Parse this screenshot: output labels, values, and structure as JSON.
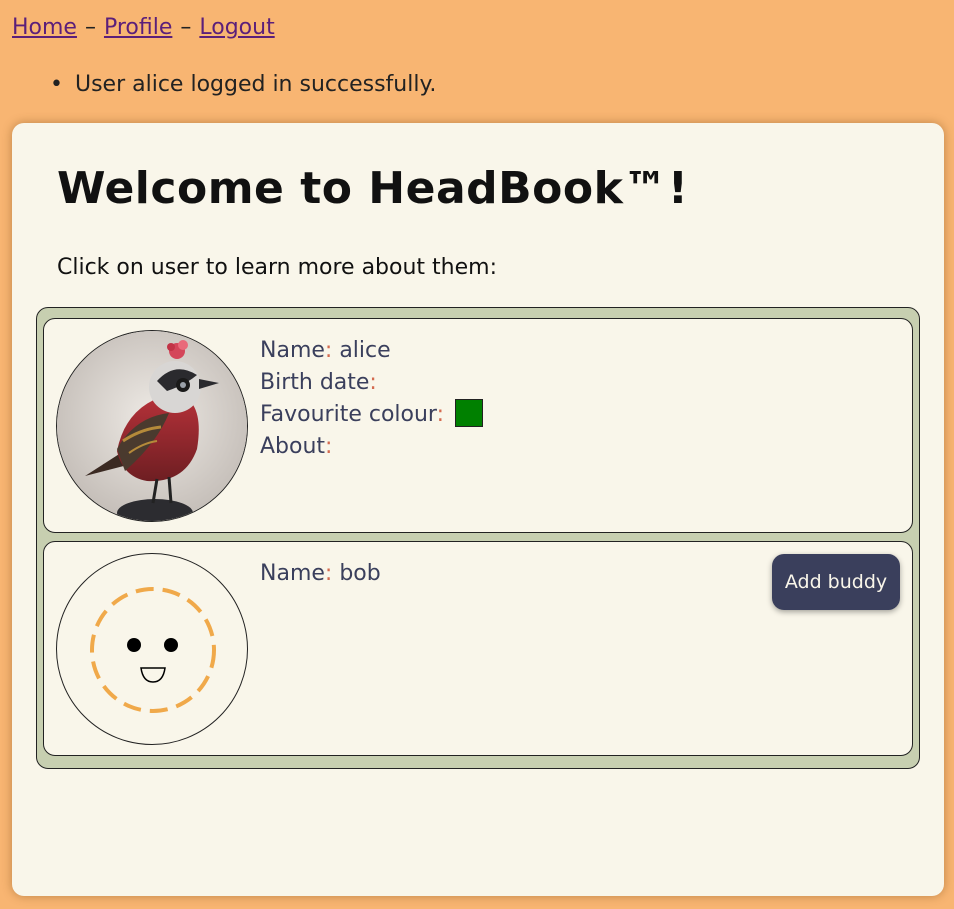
{
  "nav": {
    "home": "Home",
    "separator": "–",
    "profile": "Profile",
    "logout": "Logout"
  },
  "messages": [
    "User alice logged in successfully."
  ],
  "page": {
    "title": "Welcome to HeadBook™!",
    "intro": "Click on user to learn more about them:"
  },
  "labels": {
    "name": "Name",
    "birth_date": "Birth date",
    "favourite_colour": "Favourite colour",
    "about": "About",
    "colon": ":"
  },
  "users": [
    {
      "name": "alice",
      "birth_date": "",
      "favourite_colour": "#008000",
      "about": "",
      "avatar": "bird-photo"
    },
    {
      "name": "bob",
      "avatar": "smiley-placeholder-icon",
      "action_label": "Add buddy"
    }
  ],
  "colors": {
    "background": "#f8b572",
    "panel": "#f9f6ea",
    "list_background": "#c7cfb0",
    "button": "#3a3f5c",
    "link": "#5b1f7a",
    "placeholder_dash": "#f0a94a"
  }
}
